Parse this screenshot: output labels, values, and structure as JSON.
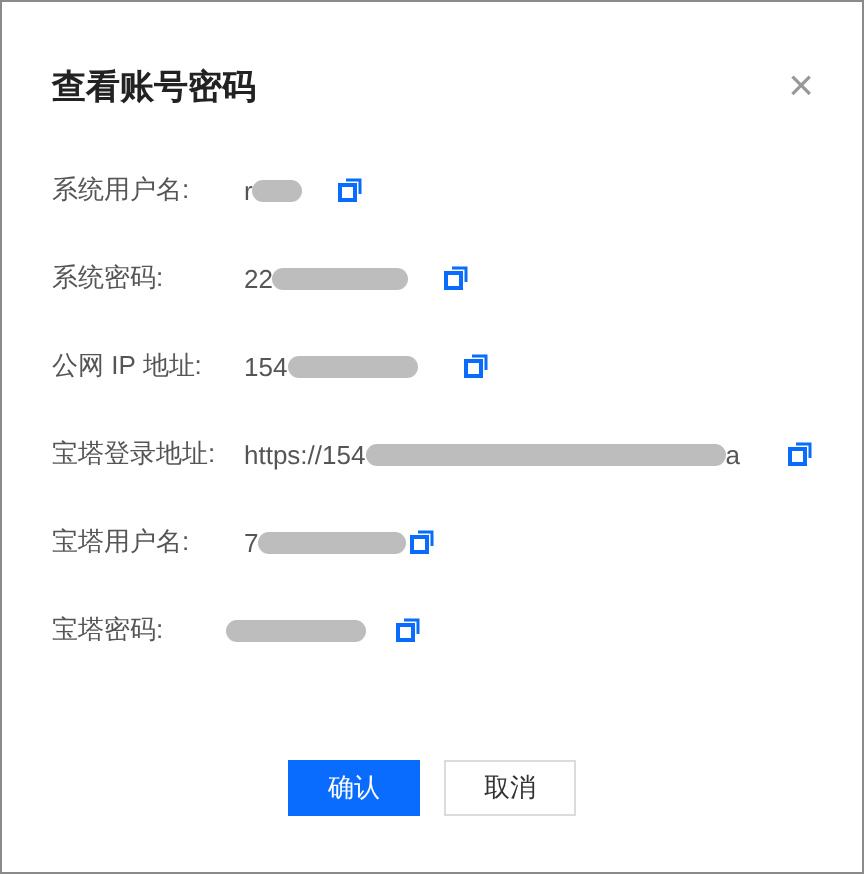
{
  "dialog": {
    "title": "查看账号密码",
    "close": "×"
  },
  "fields": [
    {
      "label": "系统用户名:",
      "value_start": "r",
      "redacted": true
    },
    {
      "label": "系统密码:",
      "value_start": "22",
      "redacted": true
    },
    {
      "label": "公网 IP 地址:",
      "value_start": "154",
      "redacted": true
    },
    {
      "label": "宝塔登录地址:",
      "value_start": "https://154",
      "redacted": true,
      "value_end": "a"
    },
    {
      "label": "宝塔用户名:",
      "value_start": "7",
      "redacted": true
    },
    {
      "label": "宝塔密码:",
      "redacted": true
    }
  ],
  "buttons": [
    {
      "label": "确认",
      "kind": "primary"
    },
    {
      "label": "取消",
      "kind": "secondary"
    }
  ]
}
